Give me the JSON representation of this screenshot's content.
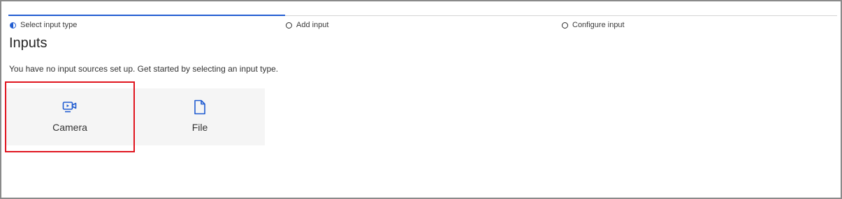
{
  "stepper": {
    "steps": [
      {
        "label": "Select input type",
        "state": "in-progress"
      },
      {
        "label": "Add input",
        "state": "pending"
      },
      {
        "label": "Configure input",
        "state": "pending"
      }
    ]
  },
  "page": {
    "title": "Inputs",
    "description": "You have no input sources set up. Get started by selecting an input type."
  },
  "input_types": [
    {
      "label": "Camera",
      "icon": "camera-icon",
      "highlighted": true
    },
    {
      "label": "File",
      "icon": "file-icon",
      "highlighted": false
    }
  ],
  "colors": {
    "accent": "#1f5bd1",
    "highlight": "#e0141e",
    "card_bg": "#f5f5f5"
  }
}
